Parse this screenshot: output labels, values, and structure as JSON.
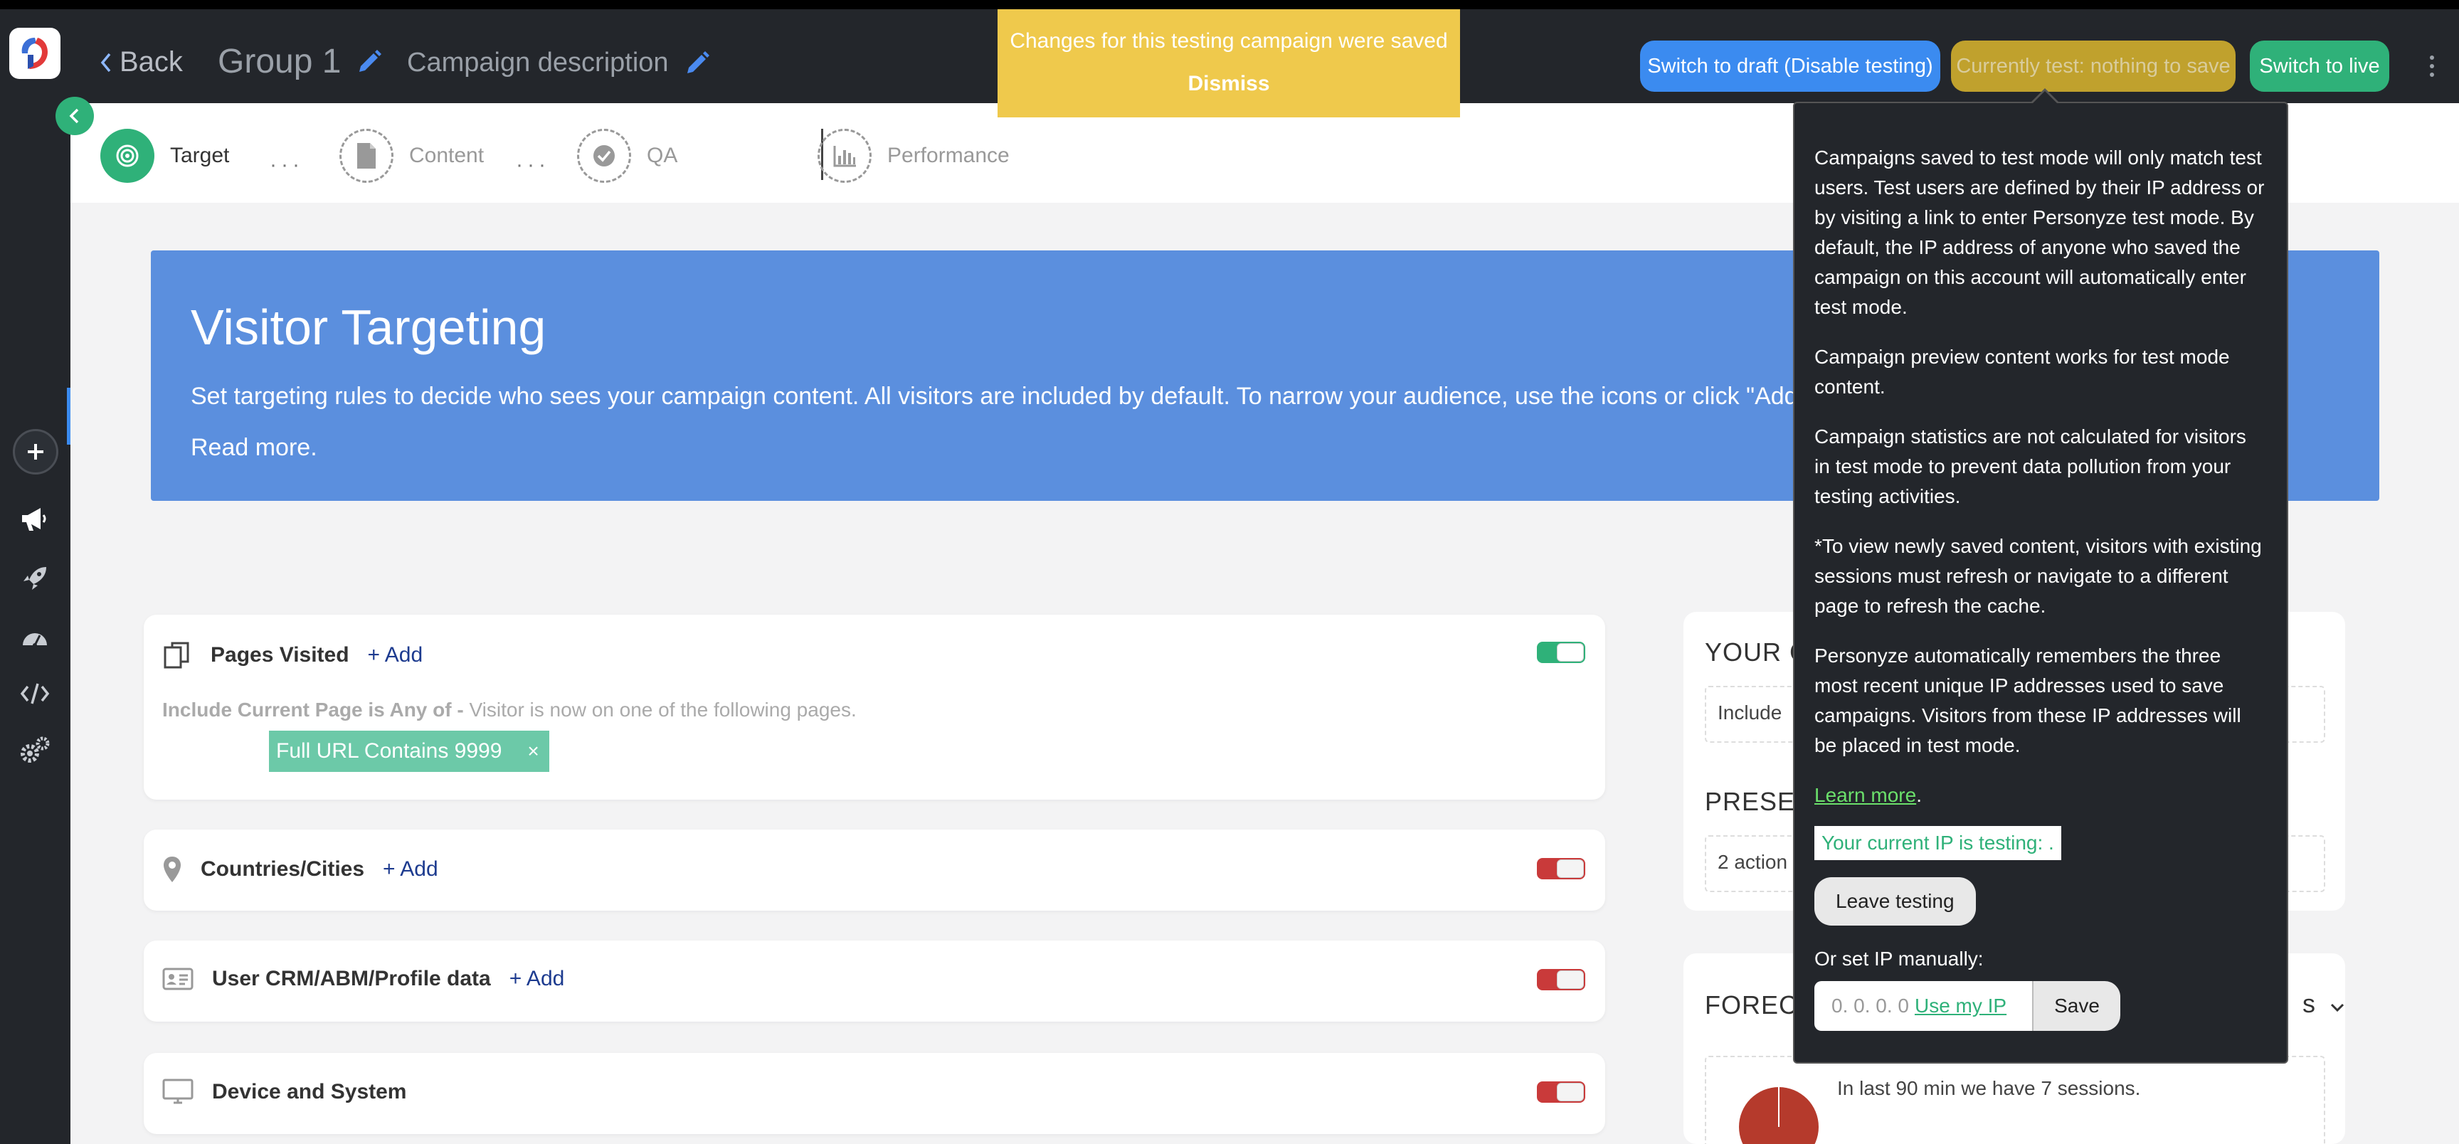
{
  "header": {
    "back_label": "Back",
    "group_title": "Group 1",
    "campaign_description": "Campaign description",
    "toast_message": "Changes for this testing campaign were saved",
    "toast_dismiss": "Dismiss",
    "btn_draft": "Switch to draft (Disable testing)",
    "btn_current": "Currently test: nothing to save",
    "btn_live": "Switch to live"
  },
  "steps": [
    {
      "label": "Target"
    },
    {
      "label": "Content"
    },
    {
      "label": "QA"
    },
    {
      "label": "Performance"
    }
  ],
  "banner": {
    "title": "Visitor Targeting",
    "description": "Set targeting rules to decide who sees your campaign content. All visitors are included by default. To narrow your audience, use the icons or click \"Add targeting",
    "read_more": "Read more."
  },
  "cards": {
    "pages_visited": {
      "title": "Pages Visited",
      "add": "+ Add",
      "include_bold": "Include Current Page is Any of - ",
      "include_text": "Visitor is now on one of the following pages.",
      "chip_label": "Full URL Contains 9999",
      "chip_close": "×"
    },
    "countries": {
      "title": "Countries/Cities",
      "add": "+ Add"
    },
    "crm": {
      "title": "User CRM/ABM/Profile data",
      "add": "+ Add"
    },
    "device": {
      "title": "Device and System"
    }
  },
  "right": {
    "your_title": "YOUR C",
    "include_text": "Include",
    "present_title": "PRESEN",
    "actions_text": "2 action",
    "forecast_title": "FORECA",
    "forecast_suffix": "s",
    "sessions_text": "In last 90 min we have 7 sessions."
  },
  "popover": {
    "p1": "Campaigns saved to test mode will only match test users. Test users are defined by their IP address or by visiting a link to enter Personyze test mode. By default, the IP address of anyone who saved the campaign on this account will automatically enter test mode.",
    "p2": "Campaign preview content works for test mode content.",
    "p3": "Campaign statistics are not calculated for visitors in test mode to prevent data pollution from your testing activities.",
    "p4": "*To view newly saved content, visitors with existing sessions must refresh or navigate to a different page to refresh the cache.",
    "p5": "Personyze automatically remembers the three most recent unique IP addresses used to save campaigns. Visitors from these IP addresses will be placed in test mode.",
    "learn_more": "Learn more",
    "learn_more_period": ".",
    "ip_testing": "Your current IP is testing: .",
    "leave_testing": "Leave testing",
    "manual_label": "Or set IP manually:",
    "ip_placeholder": "0. 0. 0. 0",
    "use_my_ip": "Use my IP",
    "save": "Save"
  },
  "colors": {
    "accent_green": "#2fb179",
    "accent_blue": "#3b8bf0",
    "toast_yellow": "#efc94c",
    "banner_blue": "#5b8fde",
    "header_dark": "#23262b"
  }
}
